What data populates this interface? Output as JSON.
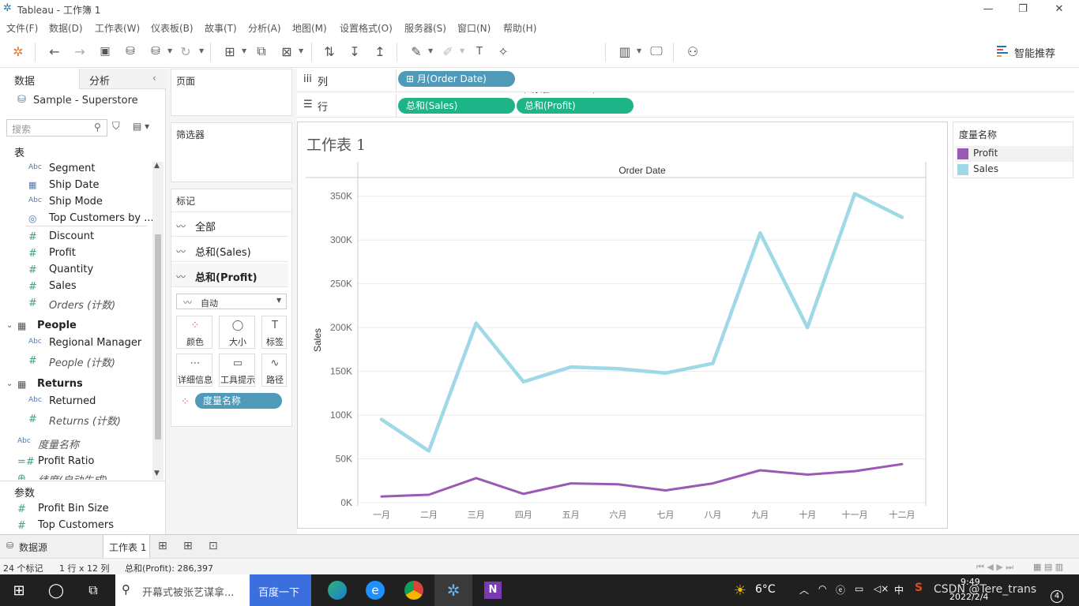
{
  "window": {
    "title": "Tableau - 工作簿 1",
    "minimize": "—",
    "restore": "❐",
    "close": "✕"
  },
  "menu": [
    "文件(F)",
    "数据(D)",
    "工作表(W)",
    "仪表板(B)",
    "故事(T)",
    "分析(A)",
    "地图(M)",
    "设置格式(O)",
    "服务器(S)",
    "窗口(N)",
    "帮助(H)"
  ],
  "toolbar": {
    "view_size": "标准",
    "smart_recommend": "智能推荐"
  },
  "data_pane": {
    "tabs": [
      "数据",
      "分析"
    ],
    "datasource": "Sample - Superstore",
    "search_placeholder": "搜索",
    "section_table": "表",
    "fields_orders": [
      {
        "type": "Abc",
        "name": "Segment"
      },
      {
        "type": "▦",
        "name": "Ship Date"
      },
      {
        "type": "Abc",
        "name": "Ship Mode"
      },
      {
        "type": "◎",
        "name": "Top Customers by ..."
      },
      {
        "type": "#",
        "name": "Discount"
      },
      {
        "type": "#",
        "name": "Profit"
      },
      {
        "type": "#",
        "name": "Quantity"
      },
      {
        "type": "#",
        "name": "Sales"
      },
      {
        "type": "#",
        "name": "Orders (计数)"
      }
    ],
    "people_title": "People",
    "people_fields": [
      {
        "type": "Abc",
        "name": "Regional Manager"
      },
      {
        "type": "#",
        "name": "People (计数)"
      }
    ],
    "returns_title": "Returns",
    "returns_fields": [
      {
        "type": "Abc",
        "name": "Returned"
      },
      {
        "type": "#",
        "name": "Returns (计数)"
      }
    ],
    "extra_fields": [
      {
        "type": "Abc",
        "name": "度量名称"
      },
      {
        "type": "=#",
        "name": "Profit Ratio"
      },
      {
        "type": "⊕",
        "name": "纬度(自动生成)"
      }
    ],
    "params_title": "参数",
    "params": [
      {
        "type": "#",
        "name": "Profit Bin Size"
      },
      {
        "type": "#",
        "name": "Top Customers"
      }
    ]
  },
  "shelves": {
    "pages": "页面",
    "filters": "筛选器",
    "marks": "标记",
    "columns_label": "列",
    "rows_label": "行",
    "column_pill": "月(Order Date)",
    "row_pills": [
      "总和(Sales)",
      "总和(Profit)"
    ],
    "mark_cards": [
      "全部",
      "总和(Sales)",
      "总和(Profit)"
    ],
    "mark_type": "自动",
    "mark_buttons": [
      {
        "label": "颜色",
        "glyph": "●"
      },
      {
        "label": "大小",
        "glyph": "◯"
      },
      {
        "label": "标签",
        "glyph": "T"
      },
      {
        "label": "详细信息",
        "glyph": "⋯"
      },
      {
        "label": "工具提示",
        "glyph": "▭"
      },
      {
        "label": "路径",
        "glyph": "∿"
      }
    ],
    "color_pill": "度量名称"
  },
  "sheet": {
    "title": "工作表 1",
    "header": "Order Date",
    "ylabel": "Sales"
  },
  "legend": {
    "title": "度量名称",
    "items": [
      {
        "name": "Profit",
        "color": "#9b59b6"
      },
      {
        "name": "Sales",
        "color": "#9fd8e6"
      }
    ]
  },
  "chart_data": {
    "type": "line",
    "categories": [
      "一月",
      "二月",
      "三月",
      "四月",
      "五月",
      "六月",
      "七月",
      "八月",
      "九月",
      "十月",
      "十一月",
      "十二月"
    ],
    "series": [
      {
        "name": "Sales",
        "color": "#9fd8e6",
        "values": [
          95000,
          59000,
          205000,
          138000,
          155000,
          153000,
          148000,
          159000,
          308000,
          200000,
          353000,
          326000
        ]
      },
      {
        "name": "Profit",
        "color": "#9b59b6",
        "values": [
          7000,
          9000,
          28000,
          10000,
          22000,
          21000,
          14000,
          22000,
          37000,
          32000,
          36000,
          44000
        ]
      }
    ],
    "ylim": [
      0,
      375000
    ],
    "yticks": [
      0,
      50000,
      100000,
      150000,
      200000,
      250000,
      300000,
      350000
    ],
    "ytick_labels": [
      "0K",
      "50K",
      "100K",
      "150K",
      "200K",
      "250K",
      "300K",
      "350K"
    ],
    "grid": true
  },
  "sheet_tabs": {
    "datasource_tab": "数据源",
    "active_sheet": "工作表 1"
  },
  "status": {
    "marks": "24 个标记",
    "dims": "1 行 x 12 列",
    "sum": "总和(Profit): 286,397"
  },
  "taskbar": {
    "search_text": "开幕式被张艺谋拿...",
    "search_button": "百度一下",
    "weather": "6°C",
    "ime": "中",
    "time": "9:49",
    "date": "2022/2/4",
    "watermark": "CSDN @Tere_trans",
    "badge": "4"
  }
}
